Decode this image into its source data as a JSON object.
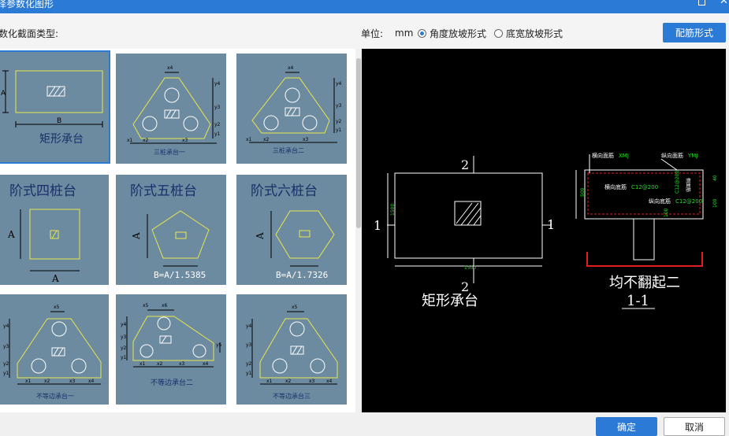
{
  "window": {
    "title": "择参数化图形"
  },
  "toolbar": {
    "section_type_label": "数化截面类型:",
    "unit_label": "单位:",
    "unit_value": "mm",
    "radio_angle": "角度放坡形式",
    "radio_width": "底宽放坡形式",
    "rebar_button": "配筋形式"
  },
  "tiles": {
    "t1": {
      "caption": "矩形承台",
      "dim_a": "A",
      "dim_b": "B"
    },
    "t2": {
      "caption": "三桩承台一",
      "labels": [
        "x4",
        "y4",
        "y3",
        "y2",
        "y1",
        "x1",
        "x2",
        "x3"
      ]
    },
    "t3": {
      "caption": "三桩承台二",
      "labels": [
        "x4",
        "y4",
        "y3",
        "y2",
        "y1",
        "x1",
        "x2",
        "x3"
      ]
    },
    "t4": {
      "caption": "阶式四桩台",
      "dim_a": "A",
      "dim_a2": "A"
    },
    "t5": {
      "caption": "阶式五桩台",
      "dim_a": "A",
      "formula": "B=A/1.5385"
    },
    "t6": {
      "caption": "阶式六桩台",
      "dim_a": "A",
      "formula": "B=A/1.7326"
    },
    "t7": {
      "caption": "不等边承台一",
      "labels": [
        "x5",
        "y4",
        "y3",
        "y2",
        "y1",
        "x1",
        "x2",
        "x3",
        "x4"
      ]
    },
    "t8": {
      "caption": "不等边承台二",
      "labels": [
        "x5",
        "x6",
        "y4",
        "y3",
        "y2",
        "y1",
        "x1",
        "x2",
        "x3",
        "x4",
        "y5"
      ]
    },
    "t9": {
      "caption": "不等边承台三",
      "labels": [
        "x5",
        "y4",
        "y3",
        "y2",
        "y1",
        "x1",
        "x2",
        "x3",
        "x4"
      ]
    }
  },
  "preview": {
    "section_mark": "2",
    "side_mark": "1",
    "plan_width": "1500",
    "plan_height": "1500",
    "plan_caption": "矩形承台",
    "top_rebar_h": "横向面筋",
    "top_rebar_h_code": "XMJ",
    "top_rebar_v": "纵向面筋",
    "top_rebar_v_code": "YMJ",
    "side_rebar": "侧面筋",
    "side_rebar_code": "C12@200",
    "bottom_rebar_h": "横向底筋",
    "bottom_rebar_h_code": "C12@200",
    "bottom_rebar_v": "纵向底筋",
    "bottom_rebar_v_code": "C12@200",
    "height_dim": "500",
    "right_dim_top": "40",
    "right_dim_bot": "100",
    "pile_dim": "100",
    "note": "均不翻起二",
    "section_label": "1-1"
  },
  "footer": {
    "ok": "确定",
    "cancel": "取消"
  },
  "colors": {
    "accent": "#2b7ad6",
    "tile_bg": "#6c8aa0",
    "shape_yellow": "#e8e84a",
    "cad_red": "#e02020",
    "cad_green": "#20e020"
  }
}
